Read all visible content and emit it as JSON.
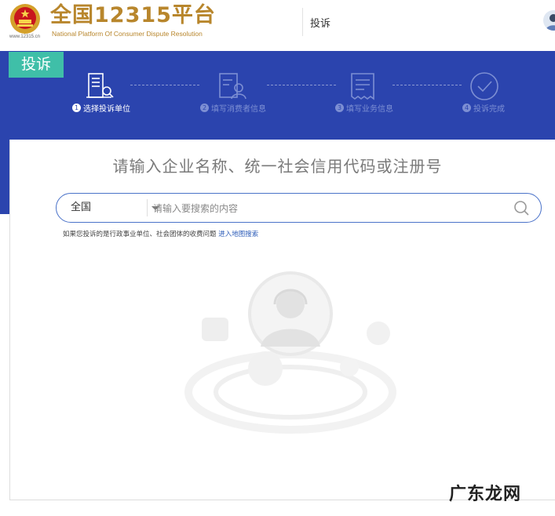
{
  "header": {
    "brand_title": "全国12315平台",
    "brand_subtitle": "National Platform Of Consumer Dispute Resolution",
    "site_url": "www.12315.cn",
    "nav_complaint": "投诉"
  },
  "banner": {
    "tag": "投诉",
    "steps": [
      {
        "num": "1",
        "label": "选择投诉单位",
        "active": true,
        "icon": "building-search-icon"
      },
      {
        "num": "2",
        "label": "填写消费者信息",
        "active": false,
        "icon": "user-form-icon"
      },
      {
        "num": "3",
        "label": "填写业务信息",
        "active": false,
        "icon": "document-icon"
      },
      {
        "num": "4",
        "label": "投诉完成",
        "active": false,
        "icon": "check-circle-icon"
      }
    ]
  },
  "search": {
    "heading": "请输入企业名称、统一社会信用代码或注册号",
    "region": "全国",
    "placeholder": "请输入要搜索的内容",
    "hint_text": "如果您投诉的是行政事业单位、社会团体的收费问题",
    "hint_link": "进入地图搜索"
  },
  "watermark": "广东龙网",
  "colors": {
    "banner": "#2b44ae",
    "tag": "#3fbfa8",
    "brand_gold": "#b8862c",
    "search_border": "#4a72c9",
    "link": "#2b5bb8"
  }
}
